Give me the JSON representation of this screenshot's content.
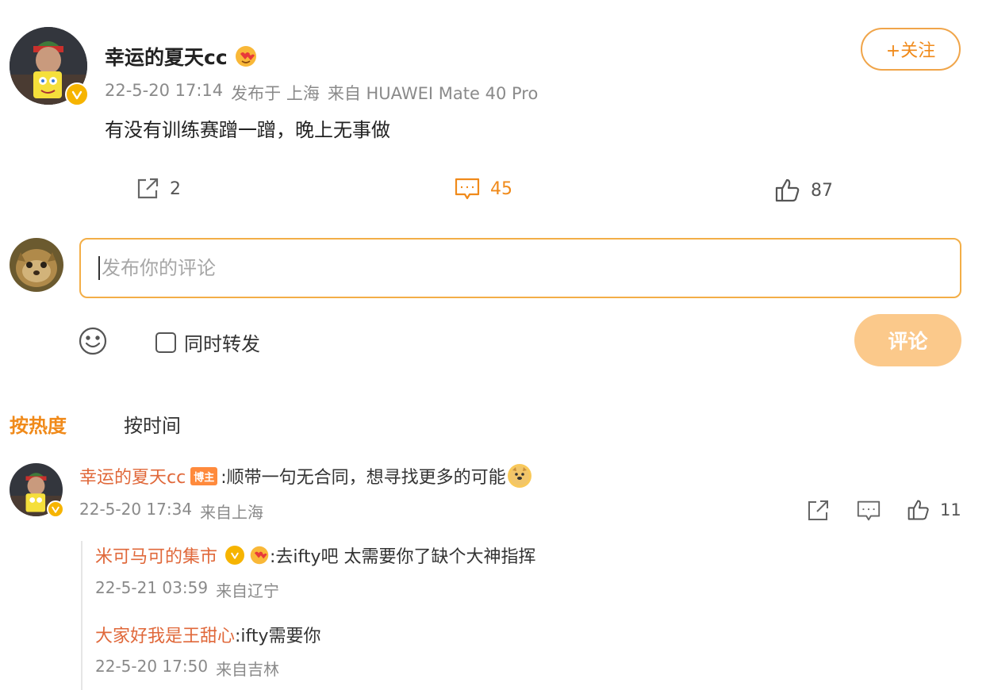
{
  "post": {
    "username": "幸运的夏天cc",
    "timestamp": "22-5-20 17:14",
    "published_in": "发布于 上海",
    "source": "来自 HUAWEI Mate 40 Pro",
    "text": "有没有训练赛蹭一蹭，晚上无事做",
    "follow_label": "+关注",
    "actions": {
      "share_count": "2",
      "comment_count": "45",
      "like_count": "87"
    }
  },
  "composer": {
    "placeholder": "发布你的评论",
    "repost_label": "同时转发",
    "submit_label": "评论"
  },
  "sort": {
    "hot_label": "按热度",
    "time_label": "按时间"
  },
  "comments": [
    {
      "username": "幸运的夏天cc",
      "tag": "博主",
      "text": ":顺带一句无合同，想寻找更多的可能",
      "timestamp": "22-5-20 17:34",
      "location": "来自上海",
      "like_count": "11",
      "replies": [
        {
          "username": "米可马可的集市",
          "text": ":去ifty吧 太需要你了缺个大神指挥",
          "timestamp": "22-5-21 03:59",
          "location": "来自辽宁"
        },
        {
          "username": "大家好我是王甜心",
          "text": ":ifty需要你",
          "timestamp": "22-5-20 17:50",
          "location": "来自吉林"
        }
      ]
    }
  ],
  "colors": {
    "accent": "#f08a1a",
    "commenter_name": "#e0683a",
    "submit_disabled": "#fbc98b"
  }
}
